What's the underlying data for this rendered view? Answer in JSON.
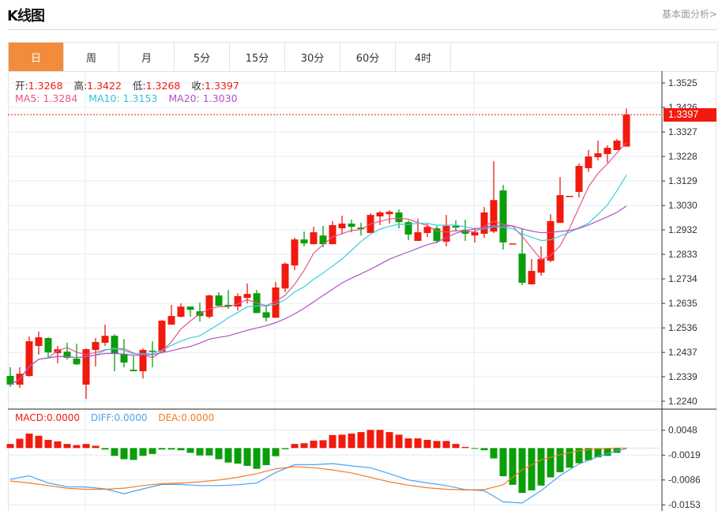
{
  "header": {
    "title": "K线图",
    "link": "基本面分析>"
  },
  "tabs": [
    {
      "label": "日",
      "active": true
    },
    {
      "label": "周"
    },
    {
      "label": "月"
    },
    {
      "label": "5分"
    },
    {
      "label": "15分"
    },
    {
      "label": "30分"
    },
    {
      "label": "60分"
    },
    {
      "label": "4时"
    }
  ],
  "legend": {
    "open_label": "开:",
    "open": "1.3268",
    "high_label": "高:",
    "high": "1.3422",
    "low_label": "低:",
    "low": "1.3268",
    "close_label": "收:",
    "close": "1.3397",
    "ma5": "MA5: 1.3284",
    "ma10": "MA10: 1.3153",
    "ma20": "MA20: 1.3030"
  },
  "macd_legend": {
    "macd": "MACD:0.0000",
    "diff": "DIFF:0.0000",
    "dea": "DEA:0.0000"
  },
  "current_price": "1.3397",
  "colors": {
    "up": "#f11a0e",
    "down": "#0a9e0a",
    "ma5": "#e8578a",
    "ma10": "#3ec9e0",
    "ma20": "#b050c8",
    "diff": "#4aa3ef",
    "dea": "#f57b20",
    "active_tab": "#f28c3c"
  },
  "chart_data": [
    {
      "type": "candlestick",
      "price_ticks": [
        "1.3525",
        "1.3426",
        "1.3327",
        "1.3228",
        "1.3129",
        "1.3030",
        "1.2932",
        "1.2833",
        "1.2734",
        "1.2635",
        "1.2536",
        "1.2437",
        "1.2339",
        "1.2240"
      ],
      "ylim": [
        1.224,
        1.3525
      ],
      "ohlc": [
        [
          1.2342,
          1.2377,
          1.2298,
          1.2307
        ],
        [
          1.2307,
          1.2377,
          1.2294,
          1.2351
        ],
        [
          1.2342,
          1.2501,
          1.2339,
          1.2482
        ],
        [
          1.2463,
          1.2521,
          1.2428,
          1.2498
        ],
        [
          1.2495,
          1.2498,
          1.2418,
          1.2437
        ],
        [
          1.2434,
          1.2463,
          1.2393,
          1.245
        ],
        [
          1.244,
          1.2476,
          1.2408,
          1.2415
        ],
        [
          1.2412,
          1.2472,
          1.2386,
          1.2389
        ],
        [
          1.2307,
          1.2453,
          1.2249,
          1.245
        ],
        [
          1.2447,
          1.2495,
          1.238,
          1.2479
        ],
        [
          1.2476,
          1.2549,
          1.2463,
          1.2504
        ],
        [
          1.2504,
          1.251,
          1.2361,
          1.2431
        ],
        [
          1.2431,
          1.2491,
          1.2377,
          1.2396
        ],
        [
          1.2367,
          1.2421,
          1.2361,
          1.2361
        ],
        [
          1.2361,
          1.2453,
          1.2332,
          1.2447
        ],
        [
          1.2444,
          1.2482,
          1.2377,
          1.244
        ],
        [
          1.244,
          1.2568,
          1.244,
          1.2565
        ],
        [
          1.2549,
          1.2629,
          1.2549,
          1.2584
        ],
        [
          1.2581,
          1.2635,
          1.2578,
          1.2622
        ],
        [
          1.2622,
          1.2622,
          1.2581,
          1.2609
        ],
        [
          1.2603,
          1.2638,
          1.2562,
          1.2584
        ],
        [
          1.2581,
          1.267,
          1.2574,
          1.2667
        ],
        [
          1.2667,
          1.268,
          1.2625,
          1.2625
        ],
        [
          1.2629,
          1.2689,
          1.2613,
          1.2622
        ],
        [
          1.2622,
          1.2676,
          1.2606,
          1.2664
        ],
        [
          1.2657,
          1.2715,
          1.2635,
          1.2673
        ],
        [
          1.2676,
          1.2689,
          1.2596,
          1.2596
        ],
        [
          1.2599,
          1.2622,
          1.2562,
          1.2577
        ],
        [
          1.2577,
          1.2721,
          1.2577,
          1.2699
        ],
        [
          1.2695,
          1.2801,
          1.268,
          1.2795
        ],
        [
          1.2788,
          1.29,
          1.2769,
          1.2893
        ],
        [
          1.2893,
          1.2925,
          1.2865,
          1.2877
        ],
        [
          1.2874,
          1.2944,
          1.2874,
          1.2922
        ],
        [
          1.2909,
          1.2948,
          1.2861,
          1.2874
        ],
        [
          1.2874,
          1.2967,
          1.2874,
          1.2951
        ],
        [
          1.2938,
          1.2989,
          1.2913,
          1.2957
        ],
        [
          1.2957,
          1.2973,
          1.2922,
          1.2944
        ],
        [
          1.2941,
          1.296,
          1.2909,
          1.2935
        ],
        [
          1.2919,
          1.2999,
          1.2919,
          1.2992
        ],
        [
          1.2986,
          1.3008,
          1.2951,
          1.3002
        ],
        [
          1.2995,
          1.3011,
          1.2957,
          1.3005
        ],
        [
          1.3002,
          1.3014,
          1.2938,
          1.2963
        ],
        [
          1.2963,
          1.297,
          1.289,
          1.2913
        ],
        [
          1.2887,
          1.2976,
          1.2887,
          1.2922
        ],
        [
          1.2919,
          1.2957,
          1.2903,
          1.2944
        ],
        [
          1.2938,
          1.2948,
          1.2877,
          1.2887
        ],
        [
          1.2884,
          1.2992,
          1.2865,
          1.2948
        ],
        [
          1.2948,
          1.297,
          1.2925,
          1.2941
        ],
        [
          1.2932,
          1.2973,
          1.2887,
          1.2916
        ],
        [
          1.2909,
          1.2941,
          1.2881,
          1.2922
        ],
        [
          1.2916,
          1.3024,
          1.29,
          1.3002
        ],
        [
          1.2925,
          1.3209,
          1.2919,
          1.3052
        ],
        [
          1.3091,
          1.3113,
          1.2852,
          1.2881
        ],
        [
          1.2877,
          1.2877,
          1.2877,
          1.2877
        ],
        [
          1.2836,
          1.2935,
          1.2708,
          1.2718
        ],
        [
          1.2712,
          1.2814,
          1.2712,
          1.2766
        ],
        [
          1.2759,
          1.2865,
          1.2747,
          1.2814
        ],
        [
          1.2807,
          1.2995,
          1.2801,
          1.2967
        ],
        [
          1.296,
          1.3145,
          1.296,
          1.3072
        ],
        [
          1.3069,
          1.3069,
          1.3069,
          1.3069
        ],
        [
          1.3085,
          1.32,
          1.3062,
          1.319
        ],
        [
          1.3181,
          1.3254,
          1.3165,
          1.3228
        ],
        [
          1.3225,
          1.3292,
          1.3212,
          1.3241
        ],
        [
          1.3238,
          1.3273,
          1.3203,
          1.3263
        ],
        [
          1.3254,
          1.3298,
          1.3254,
          1.3292
        ],
        [
          1.3268,
          1.3422,
          1.3268,
          1.3397
        ]
      ],
      "ma_periods": [
        5,
        10,
        20
      ]
    },
    {
      "type": "bar",
      "title": "MACD",
      "ticks": [
        "0.0048",
        "-0.0019",
        "-0.0086",
        "-0.0153"
      ],
      "histogram": [
        0.0011,
        0.0025,
        0.0039,
        0.0033,
        0.0022,
        0.0018,
        0.0011,
        0.0008,
        0.0011,
        0.0006,
        -0.0004,
        -0.0021,
        -0.003,
        -0.0032,
        -0.0021,
        -0.0016,
        -0.0004,
        -0.0004,
        -0.0006,
        -0.0013,
        -0.002,
        -0.002,
        -0.003,
        -0.0039,
        -0.0042,
        -0.0048,
        -0.0056,
        -0.0046,
        -0.0022,
        -0.0003,
        0.0011,
        0.0013,
        0.002,
        0.0021,
        0.0035,
        0.0036,
        0.0039,
        0.0043,
        0.0049,
        0.0049,
        0.0043,
        0.0036,
        0.0026,
        0.0026,
        0.0022,
        0.0019,
        0.0019,
        0.0011,
        0.0003,
        -0.0002,
        -0.0006,
        -0.0028,
        -0.0076,
        -0.0099,
        -0.0121,
        -0.0114,
        -0.0101,
        -0.0079,
        -0.0065,
        -0.0053,
        -0.0041,
        -0.0033,
        -0.0025,
        -0.0021,
        -0.0013
      ],
      "diff": [
        [
          0,
          -0.0084
        ],
        [
          2,
          -0.0075
        ],
        [
          4,
          -0.0094
        ],
        [
          6,
          -0.0104
        ],
        [
          8,
          -0.0105
        ],
        [
          10,
          -0.011
        ],
        [
          12,
          -0.0123
        ],
        [
          14,
          -0.011
        ],
        [
          16,
          -0.0098
        ],
        [
          18,
          -0.0098
        ],
        [
          20,
          -0.0101
        ],
        [
          22,
          -0.0101
        ],
        [
          24,
          -0.0099
        ],
        [
          26,
          -0.0094
        ],
        [
          28,
          -0.0066
        ],
        [
          30,
          -0.0045
        ],
        [
          32,
          -0.0045
        ],
        [
          34,
          -0.0042
        ],
        [
          36,
          -0.0048
        ],
        [
          38,
          -0.0053
        ],
        [
          40,
          -0.0069
        ],
        [
          42,
          -0.0086
        ],
        [
          44,
          -0.0094
        ],
        [
          46,
          -0.0101
        ],
        [
          48,
          -0.0112
        ],
        [
          50,
          -0.0115
        ],
        [
          52,
          -0.0145
        ],
        [
          54,
          -0.0148
        ],
        [
          56,
          -0.0115
        ],
        [
          58,
          -0.0074
        ],
        [
          60,
          -0.0043
        ],
        [
          62,
          -0.0023
        ],
        [
          64,
          -0.0007
        ],
        [
          65,
          -0.0002
        ]
      ],
      "dea": [
        [
          0,
          -0.0089
        ],
        [
          2,
          -0.0094
        ],
        [
          4,
          -0.0101
        ],
        [
          6,
          -0.0108
        ],
        [
          8,
          -0.0111
        ],
        [
          10,
          -0.0111
        ],
        [
          12,
          -0.0108
        ],
        [
          14,
          -0.0101
        ],
        [
          16,
          -0.0096
        ],
        [
          18,
          -0.0094
        ],
        [
          20,
          -0.0091
        ],
        [
          22,
          -0.0086
        ],
        [
          24,
          -0.0079
        ],
        [
          26,
          -0.0069
        ],
        [
          28,
          -0.0056
        ],
        [
          30,
          -0.005
        ],
        [
          32,
          -0.0053
        ],
        [
          34,
          -0.0059
        ],
        [
          36,
          -0.0067
        ],
        [
          38,
          -0.0079
        ],
        [
          40,
          -0.0091
        ],
        [
          42,
          -0.01
        ],
        [
          44,
          -0.0107
        ],
        [
          46,
          -0.0111
        ],
        [
          48,
          -0.0113
        ],
        [
          50,
          -0.0112
        ],
        [
          52,
          -0.0099
        ],
        [
          54,
          -0.0059
        ],
        [
          56,
          -0.0032
        ],
        [
          58,
          -0.0018
        ],
        [
          60,
          -0.0007
        ],
        [
          62,
          -0.0002
        ],
        [
          64,
          0.0
        ],
        [
          65,
          0.0
        ]
      ]
    }
  ]
}
